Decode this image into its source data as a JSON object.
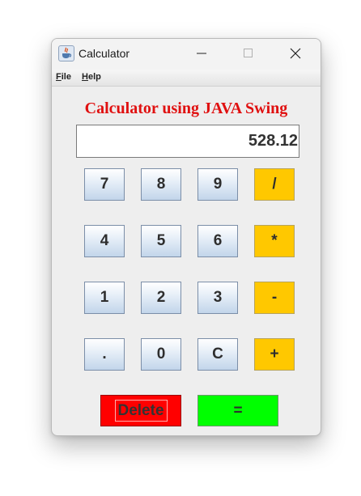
{
  "window": {
    "title": "Calculator",
    "app_icon": "java-cup-icon",
    "controls": {
      "minimize": "minimize-icon",
      "maximize": "maximize-icon",
      "close": "close-icon"
    }
  },
  "menu": {
    "file": "File",
    "help": "Help"
  },
  "heading": "Calculator using JAVA Swing",
  "display": {
    "value": "528.12"
  },
  "keys": {
    "k7": "7",
    "k8": "8",
    "k9": "9",
    "divide": "/",
    "k4": "4",
    "k5": "5",
    "k6": "6",
    "multiply": "*",
    "k1": "1",
    "k2": "2",
    "k3": "3",
    "subtract": "-",
    "decimal": ".",
    "k0": "0",
    "clear": "C",
    "add": "+",
    "delete": "Delete",
    "equals": "="
  },
  "colors": {
    "heading": "#e01010",
    "operator_keys": "#ffc800",
    "delete_key": "#ff0000",
    "equals_key": "#00ff00"
  }
}
